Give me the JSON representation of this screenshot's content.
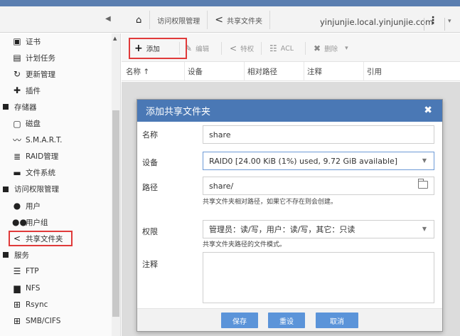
{
  "topbar": {
    "collapse_glyph": "◀",
    "home_glyph": "⌂",
    "breadcrumbs": [
      {
        "label": "访问权限管理"
      },
      {
        "label": "共享文件夹"
      }
    ],
    "share_glyph": "<",
    "hostname": "yinjunjie.local.yinjunjie.com",
    "menu_glyph": "⋮",
    "dropdown_glyph": "▾"
  },
  "sidebar": {
    "scroll_up_glyph": "▲",
    "items": [
      {
        "label": "证书",
        "icon": "certificate-icon",
        "glyph": "▣",
        "level": "child"
      },
      {
        "label": "计划任务",
        "icon": "calendar-icon",
        "glyph": "▤",
        "level": "child"
      },
      {
        "label": "更新管理",
        "icon": "refresh-icon",
        "glyph": "↻",
        "level": "child"
      },
      {
        "label": "插件",
        "icon": "plugin-icon",
        "glyph": "✚",
        "level": "child"
      },
      {
        "label": "存储器",
        "icon": "collapse-square-icon",
        "glyph": "",
        "level": "group"
      },
      {
        "label": "磁盘",
        "icon": "disk-icon",
        "glyph": "▢",
        "level": "child"
      },
      {
        "label": "S.M.A.R.T.",
        "icon": "pulse-icon",
        "glyph": "〰",
        "level": "child"
      },
      {
        "label": "RAID管理",
        "icon": "database-icon",
        "glyph": "≣",
        "level": "child"
      },
      {
        "label": "文件系统",
        "icon": "filesystem-icon",
        "glyph": "▬",
        "level": "child"
      },
      {
        "label": "访问权限管理",
        "icon": "collapse-square-icon",
        "glyph": "",
        "level": "group"
      },
      {
        "label": "用户",
        "icon": "user-icon",
        "glyph": "●",
        "level": "child"
      },
      {
        "label": "用户组",
        "icon": "users-icon",
        "glyph": "●●",
        "level": "child"
      },
      {
        "label": "共享文件夹",
        "icon": "share-icon",
        "glyph": "<",
        "level": "child"
      },
      {
        "label": "服务",
        "icon": "collapse-square-icon",
        "glyph": "",
        "level": "group"
      },
      {
        "label": "FTP",
        "icon": "server-icon",
        "glyph": "☰",
        "level": "child"
      },
      {
        "label": "NFS",
        "icon": "monitor-icon",
        "glyph": "▆",
        "level": "child"
      },
      {
        "label": "Rsync",
        "icon": "sitemap-icon",
        "glyph": "⊞",
        "level": "child"
      },
      {
        "label": "SMB/CIFS",
        "icon": "windows-icon",
        "glyph": "⊞",
        "level": "child"
      }
    ]
  },
  "toolbar": {
    "add": {
      "label": "添加",
      "glyph": "+"
    },
    "edit": {
      "label": "编辑",
      "glyph": "✎"
    },
    "privilege": {
      "label": "特权",
      "glyph": "<"
    },
    "acl": {
      "label": "ACL",
      "glyph": "☷"
    },
    "delete": {
      "label": "删除",
      "glyph": "✖"
    },
    "more_glyph": "▾"
  },
  "grid": {
    "columns": [
      {
        "label": "名称 ↑"
      },
      {
        "label": "设备"
      },
      {
        "label": "相对路径"
      },
      {
        "label": "注释"
      },
      {
        "label": "引用"
      }
    ]
  },
  "modal": {
    "title": "添加共享文件夹",
    "close_glyph": "✖",
    "caret_glyph": "▼",
    "fields": {
      "name": {
        "label": "名称",
        "value": "share"
      },
      "device": {
        "label": "设备",
        "value": "RAID0 [24.00 KiB (1%) used, 9.72 GiB available]"
      },
      "path": {
        "label": "路径",
        "value": "share/",
        "hint": "共享文件夹相对路径，如果它不存在则会创建。"
      },
      "permissions": {
        "label": "权限",
        "value": "管理员：读/写，用户：读/写，其它：只读",
        "hint": "共享文件夹路径的文件模式。"
      },
      "comment": {
        "label": "注释",
        "value": ""
      }
    },
    "buttons": {
      "save": "保存",
      "reset": "重设",
      "cancel": "取消"
    }
  },
  "colors": {
    "header_blue": "#4a78b5",
    "button_blue": "#5b94d9",
    "highlight_red": "#e03a3a"
  }
}
